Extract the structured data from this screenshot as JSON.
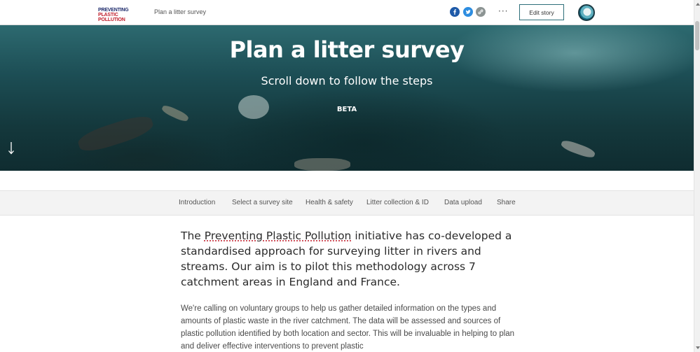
{
  "header": {
    "logo_line1": "PREVENTING",
    "logo_line2": "PLASTIC POLLUTION",
    "breadcrumb": "Plan a litter survey",
    "more_label": "···",
    "edit_label": "Edit story"
  },
  "hero": {
    "title": "Plan a litter survey",
    "subtitle": "Scroll down to follow the steps",
    "badge": "BETA"
  },
  "nav": {
    "tabs": [
      "Introduction",
      "Select a survey site",
      "Health & safety",
      "Litter collection & ID",
      "Data upload",
      "Share"
    ]
  },
  "content": {
    "lead_prefix": "The ",
    "lead_link": "Preventing Plastic Pollution",
    "lead_suffix": " initiative has co-developed a standardised approach for surveying litter in rivers and streams. Our aim is to pilot this methodology across 7 catchment areas in England and France.",
    "body": "We're calling on voluntary groups to help us gather detailed information on the types and amounts of plastic waste in the river catchment. The data will be assessed and sources of plastic pollution identified by both location and sector. This will be invaluable in helping to plan and deliver effective interventions to prevent plastic"
  },
  "colors": {
    "brand_navy": "#1d2a6b",
    "brand_red": "#c0202d",
    "accent_teal": "#2e6f7a"
  }
}
